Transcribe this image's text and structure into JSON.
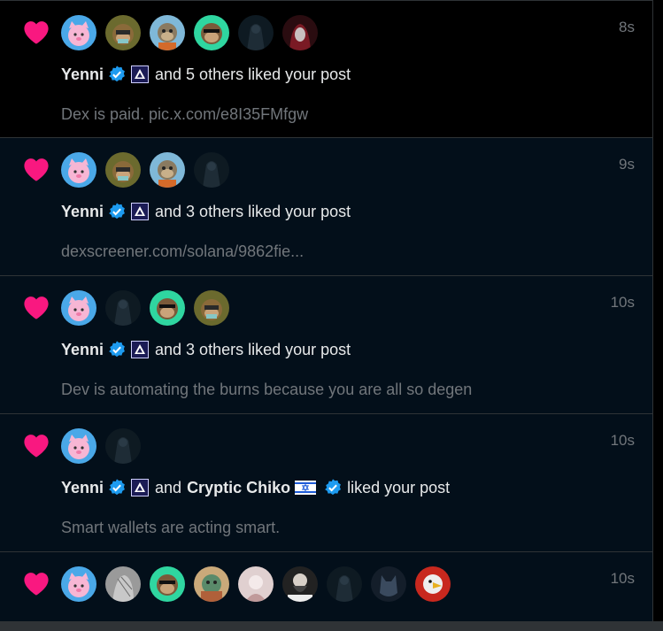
{
  "colors": {
    "heart": "#f91880",
    "verified": "#1d9bf0",
    "muted": "#71767b"
  },
  "notifications": [
    {
      "time": "8s",
      "actor": "Yenni",
      "text": "and 5 others liked your post",
      "preview": "Dex is paid. pic.x.com/e8I35FMfgw",
      "avatars": [
        "pink-cat-avatar",
        "ape-olive-avatar",
        "ape-blue-avatar",
        "ape-teal-avatar",
        "dark-figure-avatar",
        "red-hood-avatar"
      ]
    },
    {
      "time": "9s",
      "actor": "Yenni",
      "text": "and 3 others liked your post",
      "preview": "dexscreener.com/solana/9862fie...",
      "avatars": [
        "pink-cat-avatar",
        "ape-olive-avatar",
        "ape-blue-avatar",
        "dark-figure-avatar"
      ]
    },
    {
      "time": "10s",
      "actor": "Yenni",
      "text": "and 3 others liked your post",
      "preview": "Dev is automating the burns because you are all so degen",
      "avatars": [
        "pink-cat-avatar",
        "dark-figure-avatar",
        "ape-teal-avatar",
        "ape-olive-avatar"
      ]
    },
    {
      "time": "10s",
      "actor": "Yenni",
      "and_word": "and",
      "second_actor": "Cryptic Chiko",
      "text": "liked your post",
      "preview": "Smart wallets are acting smart.",
      "avatars": [
        "pink-cat-avatar",
        "dark-figure-avatar"
      ]
    },
    {
      "time": "10s",
      "avatars": [
        "pink-cat-avatar",
        "grey-sketch-avatar",
        "ape-teal-avatar",
        "colorful-ape-avatar",
        "pale-figure-avatar",
        "bearded-man-avatar",
        "dark-figure-avatar",
        "wolf-avatar",
        "red-eagle-avatar"
      ]
    }
  ]
}
